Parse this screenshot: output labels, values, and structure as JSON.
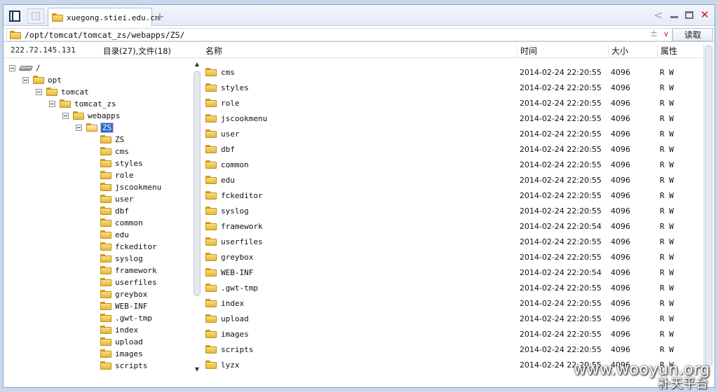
{
  "tab": {
    "title": "xuegong.stiei.edu.cn",
    "new_tab_symbol": "+"
  },
  "window": {
    "back_symbol": "<",
    "close_symbol": "✕"
  },
  "address": {
    "path": "/opt/tomcat/tomcat_zs/webapps/ZS/",
    "plus_minus": "±",
    "dropdown_symbol": "∨",
    "read_button": "读取"
  },
  "info": {
    "ip": "222.72.145.131",
    "counts": "目录(27),文件(18)"
  },
  "columns": {
    "name": "名称",
    "time": "时间",
    "size": "大小",
    "attr": "属性"
  },
  "tree": {
    "root": "/",
    "opt": "opt",
    "tomcat": "tomcat",
    "tomcat_zs": "tomcat_zs",
    "webapps": "webapps",
    "selected": "ZS",
    "children": [
      "ZS",
      "cms",
      "styles",
      "role",
      "jscookmenu",
      "user",
      "dbf",
      "common",
      "edu",
      "fckeditor",
      "syslog",
      "framework",
      "userfiles",
      "greybox",
      "WEB-INF",
      ".gwt-tmp",
      "index",
      "upload",
      "images",
      "scripts"
    ]
  },
  "files": [
    {
      "name": "cms",
      "time": "2014-02-24 22:20:55",
      "size": "4096",
      "attr": "R W"
    },
    {
      "name": "styles",
      "time": "2014-02-24 22:20:55",
      "size": "4096",
      "attr": "R W"
    },
    {
      "name": "role",
      "time": "2014-02-24 22:20:55",
      "size": "4096",
      "attr": "R W"
    },
    {
      "name": "jscookmenu",
      "time": "2014-02-24 22:20:55",
      "size": "4096",
      "attr": "R W"
    },
    {
      "name": "user",
      "time": "2014-02-24 22:20:55",
      "size": "4096",
      "attr": "R W"
    },
    {
      "name": "dbf",
      "time": "2014-02-24 22:20:55",
      "size": "4096",
      "attr": "R W"
    },
    {
      "name": "common",
      "time": "2014-02-24 22:20:55",
      "size": "4096",
      "attr": "R W"
    },
    {
      "name": "edu",
      "time": "2014-02-24 22:20:55",
      "size": "4096",
      "attr": "R W"
    },
    {
      "name": "fckeditor",
      "time": "2014-02-24 22:20:55",
      "size": "4096",
      "attr": "R W"
    },
    {
      "name": "syslog",
      "time": "2014-02-24 22:20:55",
      "size": "4096",
      "attr": "R W"
    },
    {
      "name": "framework",
      "time": "2014-02-24 22:20:54",
      "size": "4096",
      "attr": "R W"
    },
    {
      "name": "userfiles",
      "time": "2014-02-24 22:20:55",
      "size": "4096",
      "attr": "R W"
    },
    {
      "name": "greybox",
      "time": "2014-02-24 22:20:55",
      "size": "4096",
      "attr": "R W"
    },
    {
      "name": "WEB-INF",
      "time": "2014-02-24 22:20:54",
      "size": "4096",
      "attr": "R W"
    },
    {
      "name": ".gwt-tmp",
      "time": "2014-02-24 22:20:55",
      "size": "4096",
      "attr": "R W"
    },
    {
      "name": "index",
      "time": "2014-02-24 22:20:55",
      "size": "4096",
      "attr": "R W"
    },
    {
      "name": "upload",
      "time": "2014-02-24 22:20:55",
      "size": "4096",
      "attr": "R W"
    },
    {
      "name": "images",
      "time": "2014-02-24 22:20:55",
      "size": "4096",
      "attr": "R W"
    },
    {
      "name": "scripts",
      "time": "2014-02-24 22:20:55",
      "size": "4096",
      "attr": "R W"
    },
    {
      "name": "lyzx",
      "time": "2014-02-24 22:20:55",
      "size": "4096",
      "attr": "R W"
    }
  ],
  "watermark": {
    "line1": "www.wooyun.org",
    "line2": "补天平台"
  }
}
